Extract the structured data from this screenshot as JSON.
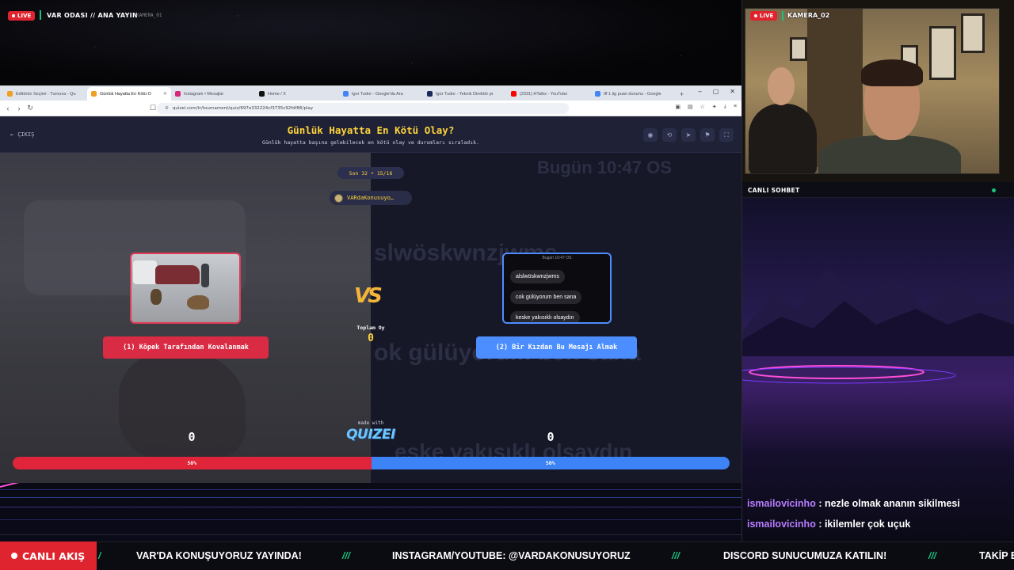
{
  "stream": {
    "live_label": "LIVE",
    "title": "VAR ODASI // ANA YAYIN",
    "camera_1": "KAMERA_01",
    "camera_2": "KAMERA_02",
    "cam_live_label": "LIVE"
  },
  "browser": {
    "tabs": [
      {
        "label": "Editörün Seçimi - Turnuva - Qu",
        "color": "#f0a020"
      },
      {
        "label": "Günlük Hayatta En Kötü O",
        "color": "#f0a020"
      },
      {
        "label": "Instagram • Mesajlar",
        "color": "#d6287a"
      },
      {
        "label": "Home / X",
        "color": "#111111"
      },
      {
        "label": "Igor Tudor - Google'da Ara",
        "color": "#4285f4"
      },
      {
        "label": "Igor Tudor - Teknik Direktör pr",
        "color": "#1b2a5a"
      },
      {
        "label": "(2331) HTalks - YouTube",
        "color": "#ff0000"
      },
      {
        "label": "tff 1.lig puan durumu - Google",
        "color": "#4285f4"
      }
    ],
    "url": "quizei.com/tr/tournament/quiz/697e332224cf3735c92fdf86/play"
  },
  "quiz": {
    "exit_label": "ÇIKIŞ",
    "title": "Günlük Hayatta En Kötü Olay?",
    "subtitle": "Günlük hayatta başına gelebilecek en kötü olay ve durumları sıraladık.",
    "round": "Son 32 • 15/16",
    "creator": "VARdaKonusuyo…",
    "vs": "VS",
    "total_label": "Toplam Oy",
    "total_value": "0",
    "made_with": "made with",
    "brand": "QUIZEI",
    "left": {
      "label": "(1) Köpek Tarafından Kovalanmak",
      "score": "0",
      "percent": "50%",
      "fraction": 0.5
    },
    "right": {
      "label": "(2) Bir Kızdan Bu Mesajı Almak",
      "score": "0",
      "percent": "50%",
      "time": "Bugün 10:47 OS",
      "messages": [
        "alslwöskwnzjwms",
        "cok gülüyorum ben sana",
        "keske yakısıklı olsaydın"
      ]
    },
    "ghost_texts": [
      "Bugün 10:47 OS",
      "slwöskwnzjwms",
      "ok gülüyorum ben sana",
      "eske yakısıklı olsaydın"
    ]
  },
  "chat": {
    "title": "CANLI SOHBET",
    "messages": [
      {
        "user": "ismailovicinho",
        "text": " : nezle olmak ananın sikilmesi"
      },
      {
        "user": "ismailovicinho",
        "text": " : ikilemler çok uçuk"
      }
    ]
  },
  "ticker": {
    "live": "CANLI AKIŞ",
    "items": [
      "VAR'DA KONUŞUYORUZ YAYINDA!",
      "INSTAGRAM/YOUTUBE: @VARDAKONUSUYORUZ",
      "DISCORD SUNUCUMUZA KATILIN!",
      "TAKİP E"
    ],
    "separator": "///"
  },
  "colors": {
    "red": "#e0242f",
    "blue": "#3d83f5",
    "yellow": "#ffd43b",
    "green": "#19c37d",
    "purple": "#b87cff"
  },
  "icons": [
    "arrow-left-icon",
    "refresh-icon",
    "star-icon",
    "eye-icon",
    "share-icon",
    "send-icon",
    "flag-icon",
    "fullscreen-icon",
    "minimize-icon",
    "maximize-icon",
    "close-icon"
  ]
}
